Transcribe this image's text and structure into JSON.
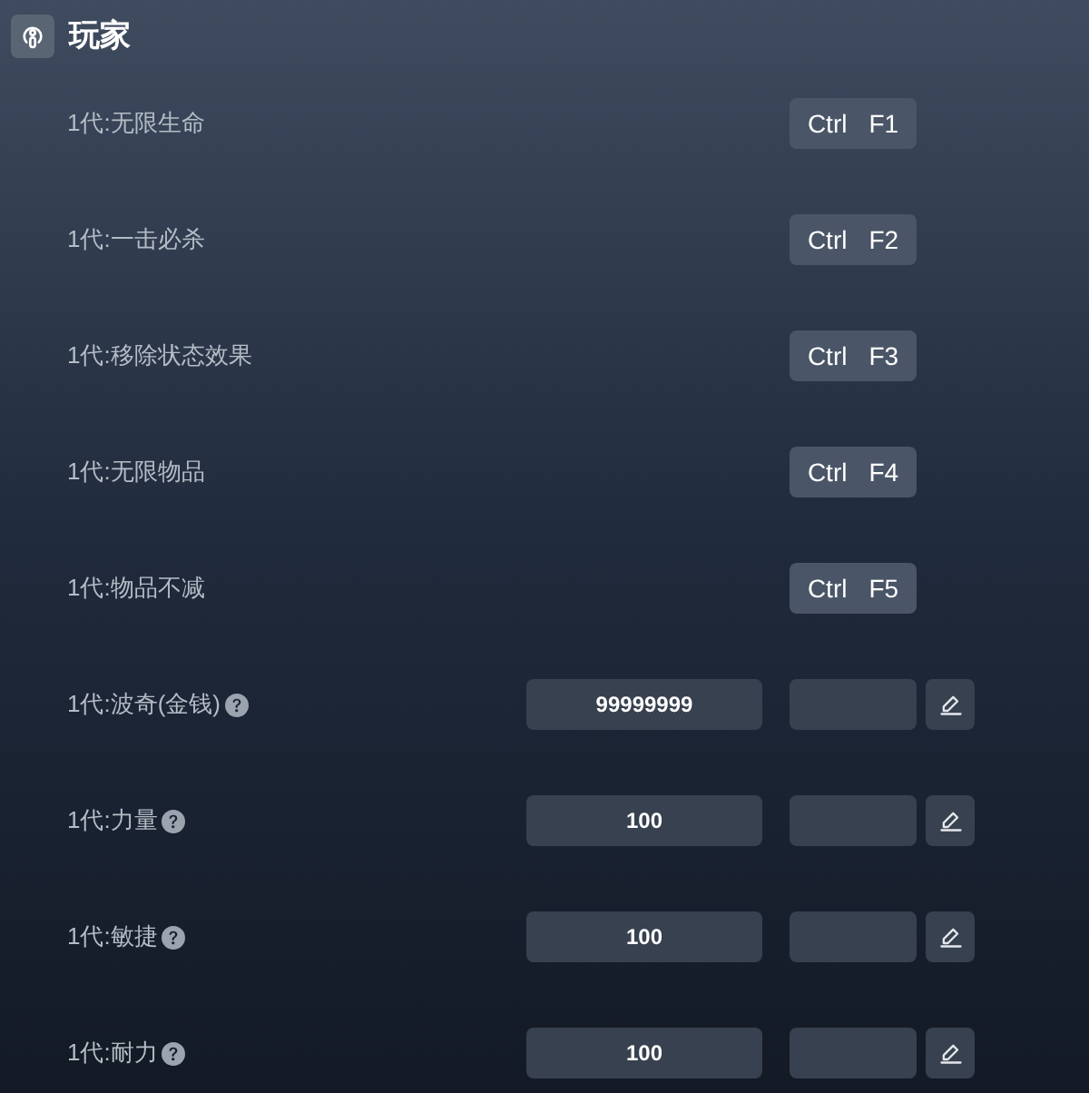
{
  "section": {
    "title": "玩家"
  },
  "rows": [
    {
      "kind": "hotkey",
      "label": "1代:无限生命",
      "keys": [
        "Ctrl",
        "F1"
      ]
    },
    {
      "kind": "hotkey",
      "label": "1代:一击必杀",
      "keys": [
        "Ctrl",
        "F2"
      ]
    },
    {
      "kind": "hotkey",
      "label": "1代:移除状态效果",
      "keys": [
        "Ctrl",
        "F3"
      ]
    },
    {
      "kind": "hotkey",
      "label": "1代:无限物品",
      "keys": [
        "Ctrl",
        "F4"
      ]
    },
    {
      "kind": "hotkey",
      "label": "1代:物品不减",
      "keys": [
        "Ctrl",
        "F5"
      ]
    },
    {
      "kind": "value",
      "label": "1代:波奇(金钱)",
      "help": true,
      "value": "99999999"
    },
    {
      "kind": "value",
      "label": "1代:力量",
      "help": true,
      "value": "100"
    },
    {
      "kind": "value",
      "label": "1代:敏捷",
      "help": true,
      "value": "100"
    },
    {
      "kind": "value",
      "label": "1代:耐力",
      "help": true,
      "value": "100"
    }
  ]
}
